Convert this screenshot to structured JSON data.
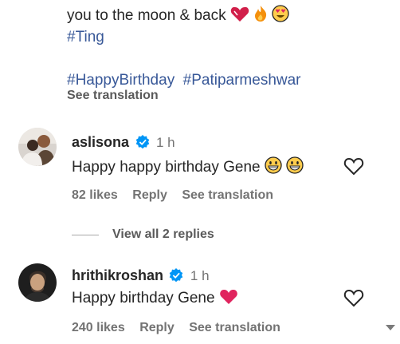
{
  "post": {
    "caption_line": "you to the moon & back",
    "hashtag_line1": "#Ting",
    "hashtag_birthday": "#HappyBirthday",
    "hashtag_pati": "#Patiparmeshwar",
    "see_translation": "See translation"
  },
  "comments": [
    {
      "username": "aslisona",
      "time": "1 h",
      "text": "Happy happy birthday Gene",
      "likes": "82 likes",
      "reply": "Reply",
      "see_translation": "See translation",
      "view_replies": "View all 2 replies"
    },
    {
      "username": "hrithikroshan",
      "time": "1 h",
      "text": "Happy birthday Gene",
      "likes": "240 likes",
      "reply": "Reply",
      "see_translation": "See translation"
    }
  ],
  "colors": {
    "hashtag": "#385898",
    "verified": "#0095f6",
    "heart_red": "#e0245e",
    "meta_gray": "#737373"
  },
  "icons": [
    "heart-emoji-icon",
    "fire-emoji-icon",
    "heart-eyes-emoji-icon",
    "verified-badge-icon",
    "grin-emoji-icon",
    "like-heart-icon",
    "red-heart-emoji-icon",
    "scroll-down-icon"
  ]
}
